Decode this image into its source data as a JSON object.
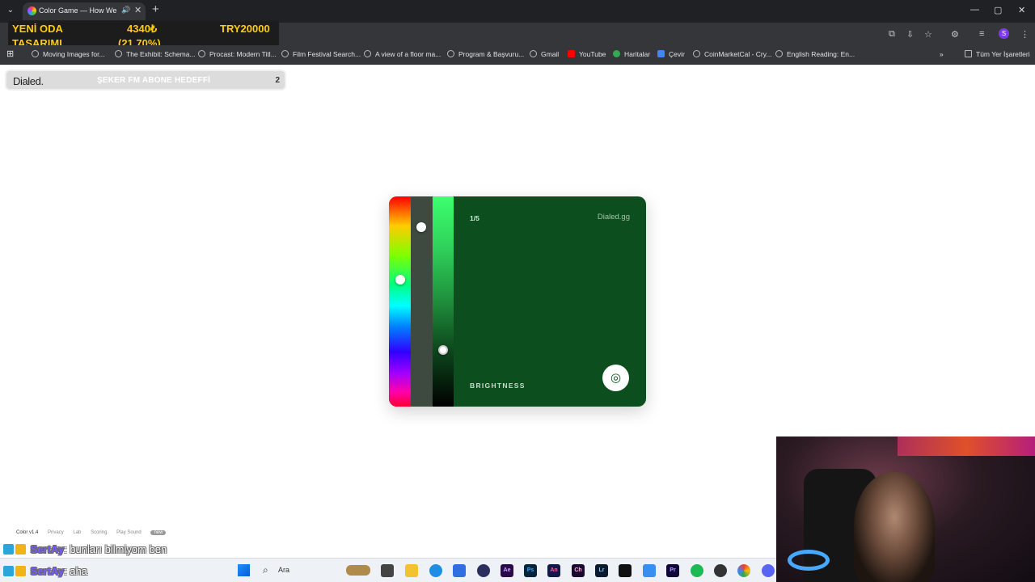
{
  "browser": {
    "tab_title": "Color Game — How Well Can You See Color?",
    "window_controls": [
      "—",
      "▢",
      "✕"
    ],
    "new_tab_symbol": "+",
    "bookmarks": [
      "Moving Images for...",
      "The Exhibit: Schema...",
      "Procast: Modern Titl...",
      "Film Festival Search...",
      "A view of a floor ma...",
      "Program & Başvuru...",
      "Gmail",
      "YouTube",
      "Haritalar",
      "Çevir",
      "CoinMarketCal - Cry...",
      "English Reading: En..."
    ],
    "bookmarks_more": "»",
    "all_bookmarks": "Tüm Yer İşaretleri",
    "profile_initial": "S"
  },
  "overlay_ticker": {
    "line1_left": "YENİ ODA",
    "line1_mid": "4340₺",
    "line1_right": "TRY20000",
    "line2_left": "TASARIMI",
    "line2_mid": "(21.70%)"
  },
  "widget": {
    "logo": "Dialed.",
    "goal_text": "ŞEKER FM ABONE HEDEFFİ",
    "count": "2"
  },
  "game": {
    "round": "1/5",
    "brand": "Dialed.gg",
    "mode": "BRIGHTNESS",
    "target_color": "#0d4e1e",
    "hue_level": 0.39,
    "saturation_level": 0.13,
    "brightness_level": 0.74
  },
  "footer": {
    "version": "Color v1.4",
    "links": [
      "Privacy",
      "Lab",
      "Scoring",
      "Play Sound"
    ],
    "new_badge": "new"
  },
  "chat": [
    {
      "user": "SertAy",
      "message": ": bunları bilmiyom ben"
    },
    {
      "user": "SertAy",
      "message": ": aha"
    }
  ],
  "taskbar": {
    "search_placeholder": "Ara",
    "apps": [
      "Ae",
      "Ps",
      "An",
      "Ch",
      "Lr",
      "Pr"
    ]
  }
}
